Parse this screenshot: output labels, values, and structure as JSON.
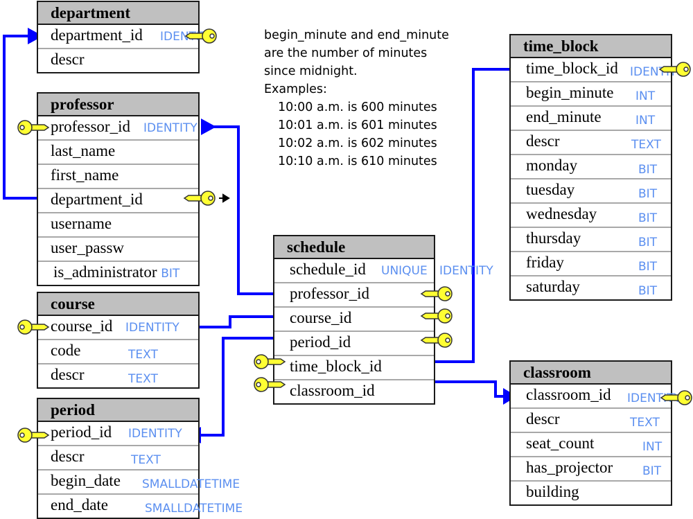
{
  "note": {
    "lines": [
      "begin_minute and end_minute",
      "are the number of minutes",
      "since midnight.",
      "Examples:"
    ],
    "examples": [
      "10:00 a.m. is 600 minutes",
      "10:01 a.m. is 601 minutes",
      "10:02 a.m. is 602 minutes",
      "10:10 a.m. is 610 minutes"
    ]
  },
  "tables": {
    "department": {
      "name": "department",
      "columns": [
        {
          "name": "department_id",
          "type": "IDENTITY"
        },
        {
          "name": "descr",
          "type": ""
        }
      ]
    },
    "professor": {
      "name": "professor",
      "columns": [
        {
          "name": "professor_id",
          "type": "IDENTITY"
        },
        {
          "name": "last_name",
          "type": ""
        },
        {
          "name": "first_name",
          "type": ""
        },
        {
          "name": "department_id",
          "type": ""
        },
        {
          "name": "username",
          "type": ""
        },
        {
          "name": "user_passw",
          "type": ""
        },
        {
          "name": "is_administrator",
          "type": "BIT"
        }
      ]
    },
    "course": {
      "name": "course",
      "columns": [
        {
          "name": "course_id",
          "type": "IDENTITY"
        },
        {
          "name": "code",
          "type": "TEXT"
        },
        {
          "name": "descr",
          "type": "TEXT"
        }
      ]
    },
    "period": {
      "name": "period",
      "columns": [
        {
          "name": "period_id",
          "type": "IDENTITY"
        },
        {
          "name": "descr",
          "type": "TEXT"
        },
        {
          "name": "begin_date",
          "type": "SMALLDATETIME"
        },
        {
          "name": "end_date",
          "type": "SMALLDATETIME"
        }
      ]
    },
    "schedule": {
      "name": "schedule",
      "columns": [
        {
          "name": "schedule_id",
          "type": "UNIQUE",
          "type2": "IDENTITY"
        },
        {
          "name": "professor_id",
          "type": ""
        },
        {
          "name": "course_id",
          "type": ""
        },
        {
          "name": "period_id",
          "type": ""
        },
        {
          "name": "time_block_id",
          "type": ""
        },
        {
          "name": "classroom_id",
          "type": ""
        }
      ]
    },
    "time_block": {
      "name": "time_block",
      "columns": [
        {
          "name": "time_block_id",
          "type": "IDENTITY"
        },
        {
          "name": "begin_minute",
          "type": "INT"
        },
        {
          "name": "end_minute",
          "type": "INT"
        },
        {
          "name": "descr",
          "type": "TEXT"
        },
        {
          "name": "monday",
          "type": "BIT"
        },
        {
          "name": "tuesday",
          "type": "BIT"
        },
        {
          "name": "wednesday",
          "type": "BIT"
        },
        {
          "name": "thursday",
          "type": "BIT"
        },
        {
          "name": "friday",
          "type": "BIT"
        },
        {
          "name": "saturday",
          "type": "BIT"
        }
      ]
    },
    "classroom": {
      "name": "classroom",
      "columns": [
        {
          "name": "classroom_id",
          "type": "IDENTITY"
        },
        {
          "name": "descr",
          "type": "TEXT"
        },
        {
          "name": "seat_count",
          "type": "INT"
        },
        {
          "name": "has_projector",
          "type": "BIT"
        },
        {
          "name": "building",
          "type": ""
        }
      ]
    }
  },
  "relationships": [
    {
      "from": "professor.department_id",
      "to": "department.department_id"
    },
    {
      "from": "schedule.professor_id",
      "to": "professor.professor_id"
    },
    {
      "from": "schedule.course_id",
      "to": "course.course_id"
    },
    {
      "from": "schedule.period_id",
      "to": "period.period_id"
    },
    {
      "from": "schedule.time_block_id",
      "to": "time_block.time_block_id"
    },
    {
      "from": "schedule.classroom_id",
      "to": "classroom.classroom_id"
    }
  ],
  "colors": {
    "link": "#0000ff",
    "type_text": "#5b8ff0",
    "header_bg": "#c0c0c0",
    "key_fill": "#ffff33"
  }
}
